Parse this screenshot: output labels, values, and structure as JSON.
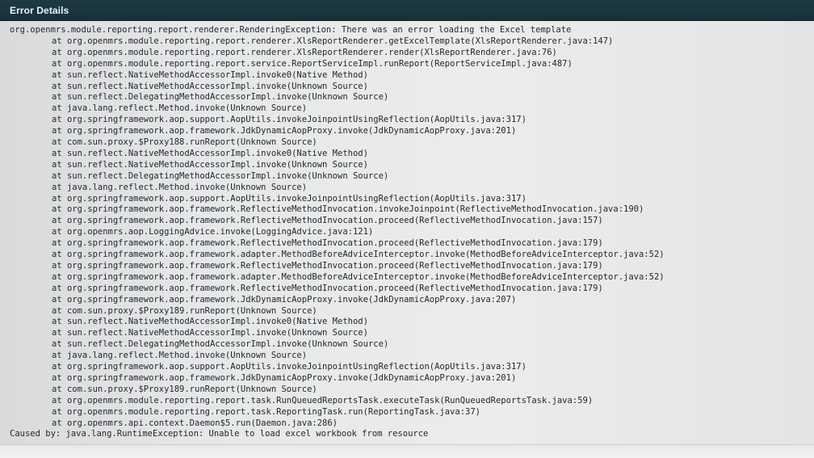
{
  "window": {
    "title": "Error Details"
  },
  "trace": {
    "lines": [
      "org.openmrs.module.reporting.report.renderer.RenderingException: There was an error loading the Excel template",
      "at org.openmrs.module.reporting.report.renderer.XlsReportRenderer.getExcelTemplate(XlsReportRenderer.java:147)",
      "at org.openmrs.module.reporting.report.renderer.XlsReportRenderer.render(XlsReportRenderer.java:76)",
      "at org.openmrs.module.reporting.report.service.ReportServiceImpl.runReport(ReportServiceImpl.java:487)",
      "at sun.reflect.NativeMethodAccessorImpl.invoke0(Native Method)",
      "at sun.reflect.NativeMethodAccessorImpl.invoke(Unknown Source)",
      "at sun.reflect.DelegatingMethodAccessorImpl.invoke(Unknown Source)",
      "at java.lang.reflect.Method.invoke(Unknown Source)",
      "at org.springframework.aop.support.AopUtils.invokeJoinpointUsingReflection(AopUtils.java:317)",
      "at org.springframework.aop.framework.JdkDynamicAopProxy.invoke(JdkDynamicAopProxy.java:201)",
      "at com.sun.proxy.$Proxy188.runReport(Unknown Source)",
      "at sun.reflect.NativeMethodAccessorImpl.invoke0(Native Method)",
      "at sun.reflect.NativeMethodAccessorImpl.invoke(Unknown Source)",
      "at sun.reflect.DelegatingMethodAccessorImpl.invoke(Unknown Source)",
      "at java.lang.reflect.Method.invoke(Unknown Source)",
      "at org.springframework.aop.support.AopUtils.invokeJoinpointUsingReflection(AopUtils.java:317)",
      "at org.springframework.aop.framework.ReflectiveMethodInvocation.invokeJoinpoint(ReflectiveMethodInvocation.java:190)",
      "at org.springframework.aop.framework.ReflectiveMethodInvocation.proceed(ReflectiveMethodInvocation.java:157)",
      "at org.openmrs.aop.LoggingAdvice.invoke(LoggingAdvice.java:121)",
      "at org.springframework.aop.framework.ReflectiveMethodInvocation.proceed(ReflectiveMethodInvocation.java:179)",
      "at org.springframework.aop.framework.adapter.MethodBeforeAdviceInterceptor.invoke(MethodBeforeAdviceInterceptor.java:52)",
      "at org.springframework.aop.framework.ReflectiveMethodInvocation.proceed(ReflectiveMethodInvocation.java:179)",
      "at org.springframework.aop.framework.adapter.MethodBeforeAdviceInterceptor.invoke(MethodBeforeAdviceInterceptor.java:52)",
      "at org.springframework.aop.framework.ReflectiveMethodInvocation.proceed(ReflectiveMethodInvocation.java:179)",
      "at org.springframework.aop.framework.JdkDynamicAopProxy.invoke(JdkDynamicAopProxy.java:207)",
      "at com.sun.proxy.$Proxy189.runReport(Unknown Source)",
      "at sun.reflect.NativeMethodAccessorImpl.invoke0(Native Method)",
      "at sun.reflect.NativeMethodAccessorImpl.invoke(Unknown Source)",
      "at sun.reflect.DelegatingMethodAccessorImpl.invoke(Unknown Source)",
      "at java.lang.reflect.Method.invoke(Unknown Source)",
      "at org.springframework.aop.support.AopUtils.invokeJoinpointUsingReflection(AopUtils.java:317)",
      "at org.springframework.aop.framework.JdkDynamicAopProxy.invoke(JdkDynamicAopProxy.java:201)",
      "at com.sun.proxy.$Proxy189.runReport(Unknown Source)",
      "at org.openmrs.module.reporting.report.task.RunQueuedReportsTask.executeTask(RunQueuedReportsTask.java:59)",
      "at org.openmrs.module.reporting.report.task.ReportingTask.run(ReportingTask.java:37)",
      "at org.openmrs.api.context.Daemon$5.run(Daemon.java:286)",
      "Caused by: java.lang.RuntimeException: Unable to load excel workbook from resource"
    ]
  },
  "colors": {
    "titlebar": "#1f3a44",
    "title_text": "#eef3f5",
    "trace_text": "#23282b",
    "panel_background": "#e6e7e8"
  }
}
